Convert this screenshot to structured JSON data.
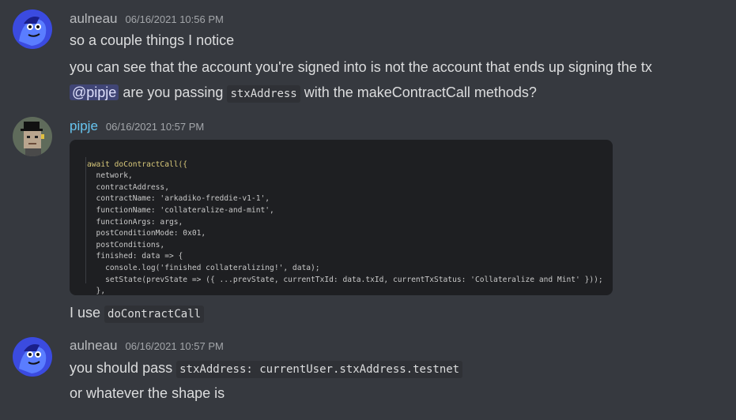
{
  "messages": [
    {
      "username": "aulneau",
      "timestamp": "06/16/2021 10:56 PM",
      "lines": {
        "l1": "so a couple things I notice",
        "l2": "you can see that the account you're signed into is not the account that ends up signing the tx",
        "l3_mention": "@pipje",
        "l3_a": "are you passing",
        "l3_code": "stxAddress",
        "l3_b": "with the makeContractCall methods?"
      }
    },
    {
      "username": "pipje",
      "timestamp": "06/16/2021 10:57 PM",
      "code_lines": [
        "await doContractCall({",
        "  network,",
        "  contractAddress,",
        "  contractName: 'arkadiko-freddie-v1-1',",
        "  functionName: 'collateralize-and-mint',",
        "  functionArgs: args,",
        "  postConditionMode: 0x01,",
        "  postConditions,",
        "  finished: data => {",
        "    console.log('finished collateralizing!', data);",
        "    setState(prevState => ({ ...prevState, currentTxId: data.txId, currentTxStatus: 'Collateralize and Mint' }));",
        "  },",
        "});"
      ],
      "line_a": "I use",
      "line_code": "doContractCall"
    },
    {
      "username": "aulneau",
      "timestamp": "06/16/2021 10:57 PM",
      "line_a": "you should pass",
      "line_code": "stxAddress: currentUser.stxAddress.testnet",
      "line_b": "or whatever the shape is"
    }
  ],
  "colors": {
    "background": "#36393f",
    "aulneau_name": "#b9bbbe",
    "pipje_name": "#66c5f0",
    "mention_bg": "#414675"
  },
  "icons": {
    "aulneau_avatar": "blue-cartoon-creature-avatar",
    "pipje_avatar": "pixel-punk-top-hat-avatar"
  }
}
